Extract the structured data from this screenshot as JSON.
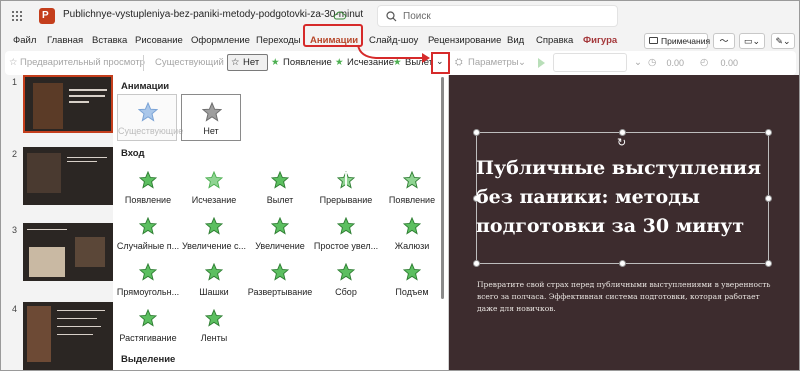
{
  "titlebar": {
    "doc_title": "Publichnye-vystupleniya-bez-paniki-metody-podgotovki-za-30-minut",
    "search_placeholder": "Поиск"
  },
  "menu": {
    "tabs": [
      "Файл",
      "Главная",
      "Вставка",
      "Рисование",
      "Оформление",
      "Переходы",
      "Анимации",
      "Слайд-шоу",
      "Рецензирование",
      "Вид",
      "Справка",
      "Фигура"
    ],
    "active_tab": "Анимации",
    "notes_label": "Примечания"
  },
  "ribbon": {
    "preview": "Предварительный просмотр",
    "existing": "Существующий",
    "none": "Нет",
    "appear": "Появление",
    "fade": "Исчезание",
    "fly": "Вылет",
    "params": "Параметры",
    "delay_value": "0.00",
    "duration_value": "0.00"
  },
  "slides": {
    "numbers": [
      "1",
      "2",
      "3",
      "4"
    ],
    "selected": 1
  },
  "panel": {
    "animations_header": "Анимации",
    "existing_label": "Существующие",
    "none_label": "Нет",
    "entrance_header": "Вход",
    "entrance_items": [
      "Появление",
      "Исчезание",
      "Вылет",
      "Прерывание",
      "Появление",
      "Случайные п...",
      "Увеличение с...",
      "Увеличение",
      "Простое увел...",
      "Жалюзи",
      "Прямоугольн...",
      "Шашки",
      "Развертывание",
      "Сбор",
      "Подъем",
      "Растягивание",
      "Ленты"
    ],
    "emphasis_header": "Выделение"
  },
  "slide": {
    "title": "Публичные выступления без паники: методы подготовки за 30 минут",
    "subtitle": "Превратите свой страх перед публичными выступлениями в уверенность всего за полчаса. Эффективная система подготовки, которая работает даже для новичков."
  },
  "colors": {
    "accent": "#c43e1c",
    "highlight": "#d62a2a",
    "star_green": "#4caf50",
    "slide_bg": "#3d2c2e"
  }
}
